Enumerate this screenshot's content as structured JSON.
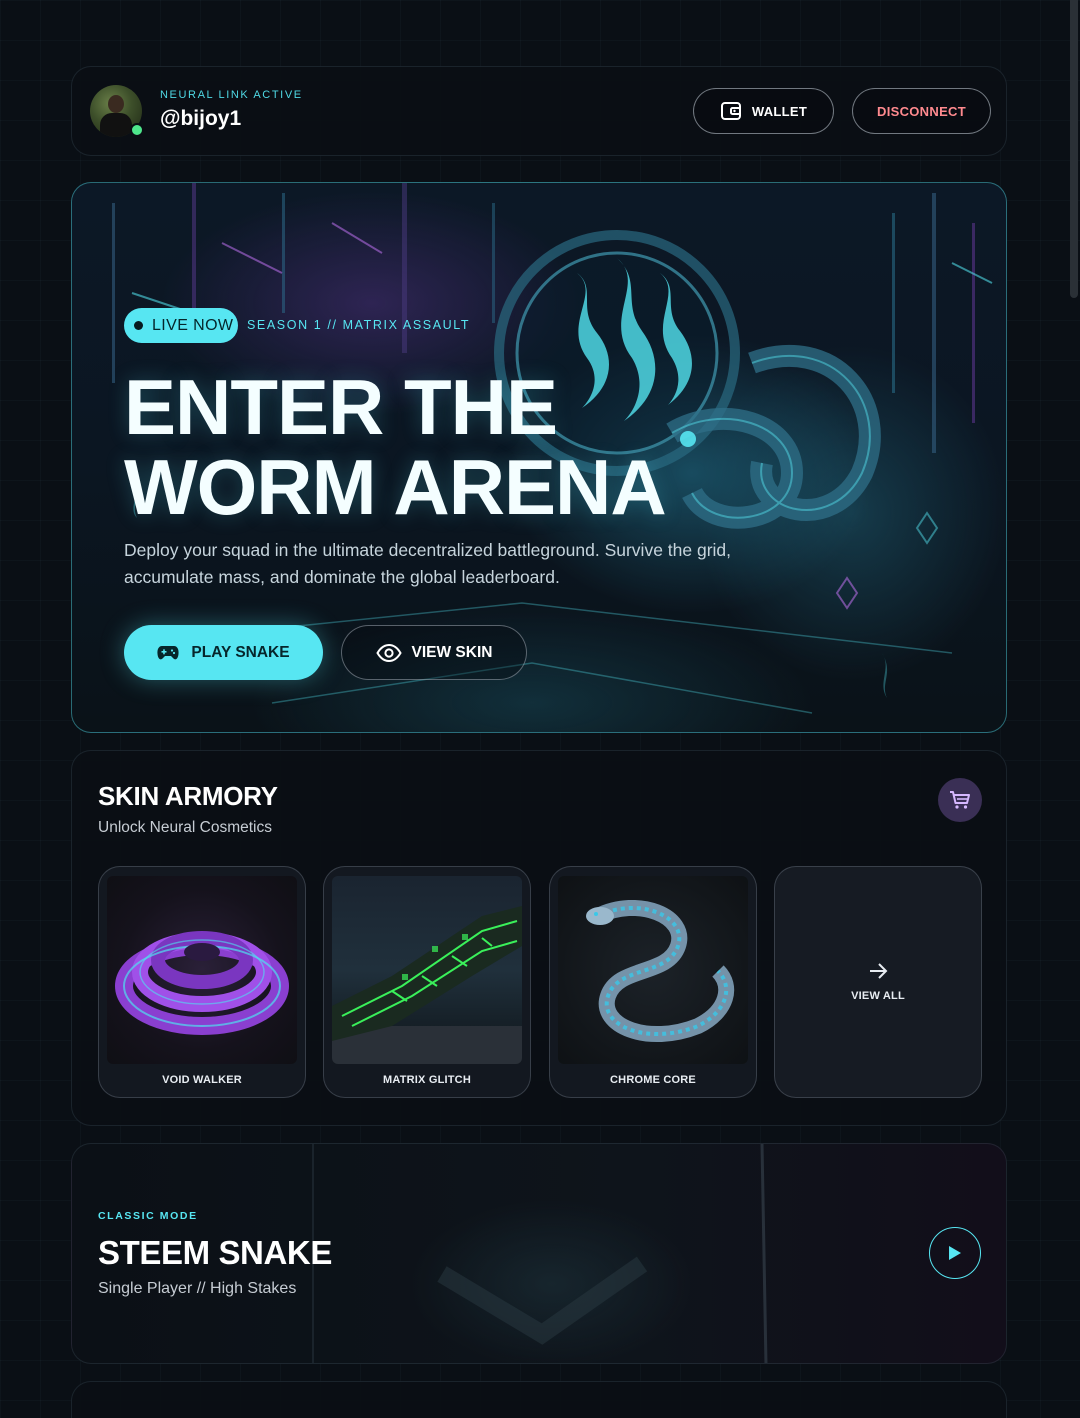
{
  "header": {
    "status_label": "NEURAL LINK ACTIVE",
    "username": "@bijoy1",
    "wallet_label": "WALLET",
    "disconnect_label": "DISCONNECT"
  },
  "hero": {
    "live_label": "LIVE NOW",
    "season_label": "SEASON 1 // MATRIX ASSAULT",
    "title_line1": "ENTER THE",
    "title_line2": "WORM ARENA",
    "description": "Deploy your squad in the ultimate decentralized battleground. Survive the grid, accumulate mass, and dominate the global leaderboard.",
    "play_label": "PLAY SNAKE",
    "view_skin_label": "VIEW SKIN"
  },
  "armory": {
    "title": "SKIN ARMORY",
    "subtitle": "Unlock Neural Cosmetics",
    "skins": [
      {
        "label": "VOID WALKER"
      },
      {
        "label": "MATRIX GLITCH"
      },
      {
        "label": "CHROME CORE"
      }
    ],
    "view_all_label": "VIEW ALL"
  },
  "classic": {
    "mode_label": "CLASSIC MODE",
    "title": "STEEM SNAKE",
    "subtitle": "Single Player // High Stakes"
  },
  "colors": {
    "accent": "#57e6f2",
    "danger": "#ff8a8f",
    "background": "#0a0f15"
  },
  "icons": {
    "wallet": "wallet-icon",
    "gamepad": "gamepad-icon",
    "eye": "eye-icon",
    "cart": "cart-icon",
    "arrow": "arrow-right-icon",
    "play": "play-icon"
  }
}
